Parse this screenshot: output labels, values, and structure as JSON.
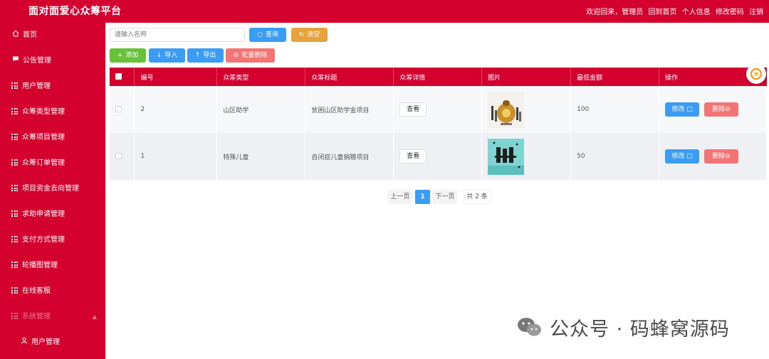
{
  "header": {
    "app_title": "面对面爱心众筹平台",
    "welcome": "欢迎回来，管理员",
    "links": [
      "回到首页",
      "个人信息",
      "修改密码",
      "注销"
    ]
  },
  "sidebar": {
    "items": [
      {
        "label": "首页",
        "icon": "home-icon"
      },
      {
        "label": "公告管理",
        "icon": "message-icon"
      },
      {
        "label": "用户管理",
        "icon": "grid-icon"
      },
      {
        "label": "众筹类型管理",
        "icon": "grid-icon"
      },
      {
        "label": "众筹项目管理",
        "icon": "grid-icon"
      },
      {
        "label": "众筹订单管理",
        "icon": "grid-icon"
      },
      {
        "label": "项目资金去向管理",
        "icon": "grid-icon"
      },
      {
        "label": "求助申请管理",
        "icon": "grid-icon"
      },
      {
        "label": "支付方式管理",
        "icon": "grid-icon"
      },
      {
        "label": "轮播图管理",
        "icon": "grid-icon"
      },
      {
        "label": "在线客服",
        "icon": "grid-icon"
      },
      {
        "label": "系统管理",
        "icon": "grid-icon"
      },
      {
        "label": "用户管理",
        "icon": "user-icon"
      }
    ]
  },
  "search": {
    "placeholder": "请输入名称",
    "query_label": "查询",
    "clear_label": "清空"
  },
  "toolbar": {
    "add_label": "添加",
    "import_label": "导入",
    "export_label": "导出",
    "batch_delete_label": "批量删除"
  },
  "table": {
    "columns": [
      "编号",
      "众筹类型",
      "众筹标题",
      "众筹详情",
      "图片",
      "最低金额",
      "操作"
    ],
    "rows": [
      {
        "id": "2",
        "type": "山区助学",
        "title": "贫困山区助学金项目",
        "detail_label": "查看",
        "image": "mountain-school-fundraising-image",
        "min_amount": "100",
        "edit_label": "修改",
        "delete_label": "删除"
      },
      {
        "id": "1",
        "type": "特殊儿童",
        "title": "自闭症儿童捐赠项目",
        "detail_label": "查看",
        "image": "crowdfunding-poster-image",
        "min_amount": "50",
        "edit_label": "修改",
        "delete_label": "删除"
      }
    ]
  },
  "pagination": {
    "prev_label": "上一页",
    "current_page": "1",
    "next_label": "下一页",
    "total_text": "共 2 条"
  },
  "watermark": {
    "text": "公众号 · 码蜂窝源码"
  },
  "colors": {
    "brand": "#d4002e",
    "primary": "#3a9cf3",
    "success": "#67c23a",
    "warning": "#e6a23c",
    "danger": "#f27474"
  }
}
